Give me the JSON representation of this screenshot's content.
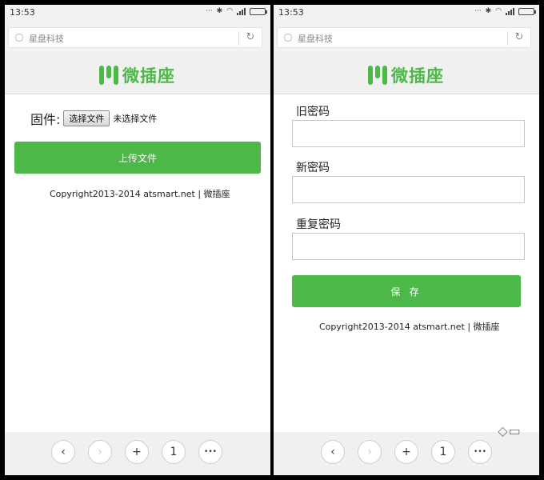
{
  "status_bar": {
    "time": "13:53"
  },
  "browser": {
    "site_name": "星盘科技"
  },
  "brand": {
    "name": "微插座",
    "color": "#4cb848"
  },
  "firmware_page": {
    "file_label": "固件:",
    "choose_button": "选择文件",
    "file_status": "未选择文件",
    "upload_button": "上传文件",
    "copyright": "Copyright2013-2014 atsmart.net | 微插座"
  },
  "password_page": {
    "old_label": "旧密码",
    "new_label": "新密码",
    "repeat_label": "重复密码",
    "save_button": "保 存",
    "copyright": "Copyright2013-2014 atsmart.net | 微插座"
  },
  "bottom_nav": {
    "back": "‹",
    "forward": "›",
    "new_tab": "+",
    "tab_count": "1",
    "menu": "•••"
  },
  "icons": [
    "wifi-icon",
    "bluetooth-icon",
    "signal-icon",
    "battery-icon",
    "reload-icon",
    "back-icon",
    "forward-icon",
    "plus-icon",
    "menu-icon"
  ]
}
